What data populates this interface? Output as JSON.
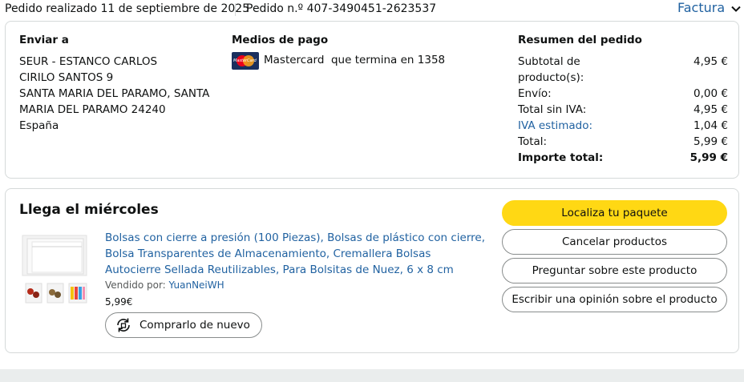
{
  "header": {
    "order_date": "Pedido realizado 11 de septiembre de 2025",
    "order_number": "Pedido n.º 407-3490451-2623537",
    "invoice_label": "Factura",
    "invoice_icon": "chevron-down-icon"
  },
  "shipping": {
    "title": "Enviar a",
    "lines": [
      "SEUR - ESTANCO CARLOS",
      "CIRILO SANTOS 9",
      "SANTA MARIA DEL PARAMO, SANTA",
      "MARIA DEL PARAMO 24240",
      "España"
    ]
  },
  "payment": {
    "title": "Medios de pago",
    "card_icon": "mastercard-icon",
    "card_logo_text": "MasterCard",
    "card_text": "Mastercard  que termina en 1358"
  },
  "summary": {
    "title": "Resumen del pedido",
    "rows": [
      {
        "label": "Subtotal de producto(s):",
        "value": "4,95 €"
      },
      {
        "label": "Envío:",
        "value": "0,00 €"
      },
      {
        "label": "Total sin IVA:",
        "value": "4,95 €"
      },
      {
        "label": "IVA estimado:",
        "value": "1,04 €"
      },
      {
        "label": "Total:",
        "value": "5,99 €"
      },
      {
        "label": "Importe total:",
        "value": "5,99 €"
      }
    ]
  },
  "shipment": {
    "arrival": "Llega el miércoles",
    "product_title": "Bolsas con cierre a presión (100 Piezas), Bolsas de plástico con cierre, Bolsa Transparentes de Almacenamiento, Cremallera Bolsas Autocierre Sellada Reutilizables, Para Bolsitas de Nuez, 6 x 8 cm",
    "sold_by_label": "Vendido por:",
    "seller": "YuanNeiWH",
    "price": "5,99€",
    "rebuy_label": "Comprarlo de nuevo",
    "rebuy_icon": "rebuy-icon"
  },
  "actions": {
    "track": "Localiza tu paquete",
    "cancel": "Cancelar productos",
    "ask": "Preguntar sobre este producto",
    "review": "Escribir una opinión sobre el producto"
  },
  "colors": {
    "primary_button": "#ffd814",
    "link": "#2162a1",
    "border": "#d5d9d9"
  }
}
